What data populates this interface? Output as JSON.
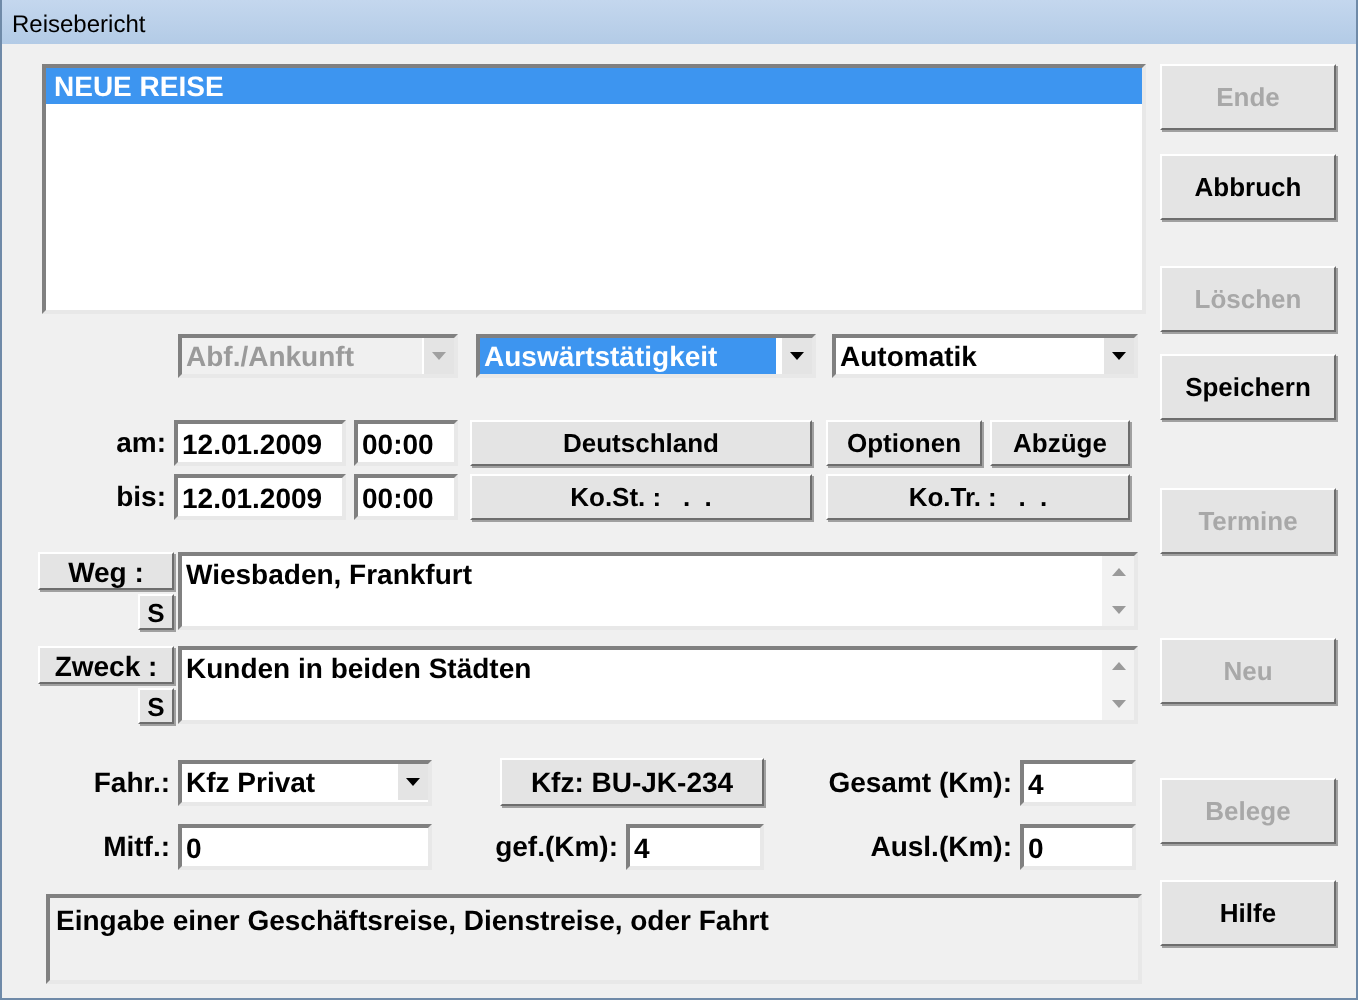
{
  "window": {
    "title": "Reisebericht"
  },
  "trip_list": {
    "items": [
      {
        "label": "NEUE REISE",
        "selected": true
      }
    ]
  },
  "selectors": [
    {
      "value": "Abf./Ankunft",
      "disabled": true,
      "focused": false
    },
    {
      "value": "Auswärtstätigkeit",
      "disabled": false,
      "focused": true
    },
    {
      "value": "Automatik",
      "disabled": false,
      "focused": false
    }
  ],
  "date_rows": [
    {
      "label": "am:",
      "date": "12.01.2009",
      "time": "00:00",
      "buttons": [
        "Deutschland",
        "Optionen",
        "Abzüge"
      ]
    },
    {
      "label": "bis:",
      "date": "12.01.2009",
      "time": "00:00",
      "buttons": [
        "Ko.St. :   .  .",
        "Ko.Tr. :   .  ."
      ]
    }
  ],
  "text_fields": [
    {
      "button": "Weg :",
      "s_button": "S",
      "value": "Wiesbaden, Frankfurt"
    },
    {
      "button": "Zweck :",
      "s_button": "S",
      "value": "Kunden in beiden Städten"
    }
  ],
  "bottom_rows": [
    [
      {
        "kind": "select",
        "label": "Fahr.:",
        "value": "Kfz Privat"
      },
      {
        "kind": "button",
        "label": "Kfz: BU-JK-234"
      },
      {
        "kind": "input",
        "label": "Gesamt (Km):",
        "value": "4"
      }
    ],
    [
      {
        "kind": "input",
        "label": "Mitf.:",
        "value": "0"
      },
      {
        "kind": "input",
        "label": "gef.(Km):",
        "value": "4"
      },
      {
        "kind": "input",
        "label": "Ausl.(Km):",
        "value": "0"
      }
    ]
  ],
  "status_message": "Eingabe einer Geschäftsreise, Dienstreise, oder Fahrt",
  "side_buttons": [
    {
      "label": "Ende",
      "disabled": true
    },
    {
      "label": "Abbruch",
      "disabled": false
    },
    {
      "label": "Löschen",
      "disabled": true
    },
    {
      "label": "Speichern",
      "disabled": false
    },
    {
      "label": "Termine",
      "disabled": true
    },
    {
      "label": "Neu",
      "disabled": true
    },
    {
      "label": "Belege",
      "disabled": true
    },
    {
      "label": "Hilfe",
      "disabled": false
    }
  ]
}
